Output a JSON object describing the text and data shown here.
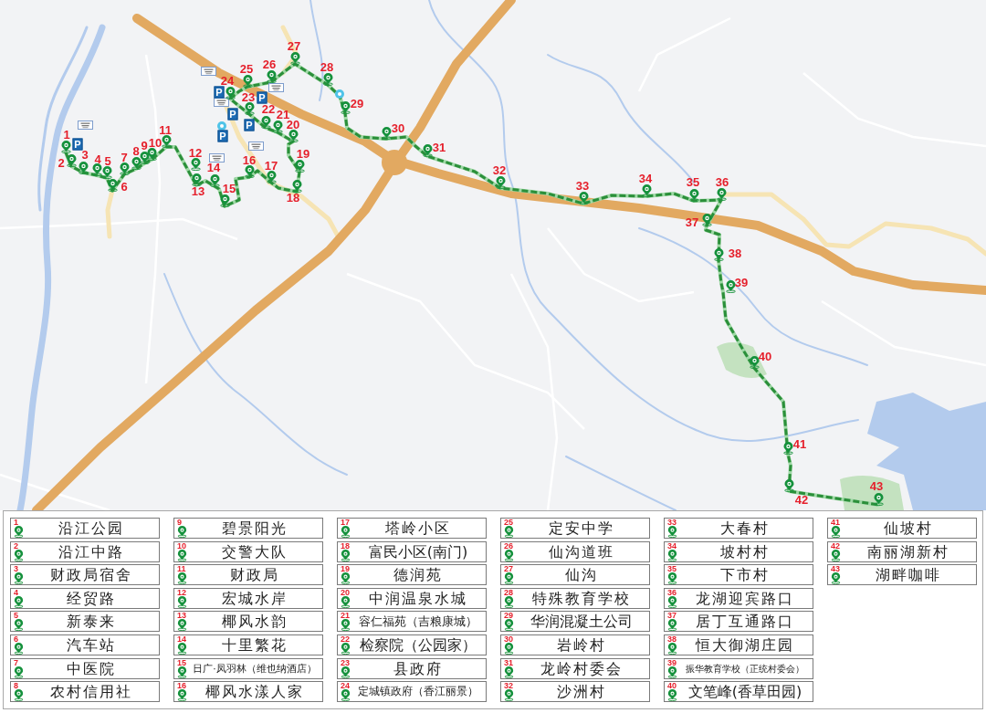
{
  "map": {
    "parking_signs": [
      {
        "label": "P"
      },
      {
        "label": "P"
      },
      {
        "label": "P"
      },
      {
        "label": "P"
      },
      {
        "label": "P"
      },
      {
        "label": "P"
      }
    ],
    "stops": [
      {
        "number": "1"
      },
      {
        "number": "2"
      },
      {
        "number": "3"
      },
      {
        "number": "4"
      },
      {
        "number": "5"
      },
      {
        "number": "6"
      },
      {
        "number": "7"
      },
      {
        "number": "8"
      },
      {
        "number": "9"
      },
      {
        "number": "10"
      },
      {
        "number": "11"
      },
      {
        "number": "12"
      },
      {
        "number": "13"
      },
      {
        "number": "14"
      },
      {
        "number": "15"
      },
      {
        "number": "16"
      },
      {
        "number": "17"
      },
      {
        "number": "18"
      },
      {
        "number": "19"
      },
      {
        "number": "20"
      },
      {
        "number": "21"
      },
      {
        "number": "22"
      },
      {
        "number": "23"
      },
      {
        "number": "24"
      },
      {
        "number": "25"
      },
      {
        "number": "26"
      },
      {
        "number": "27"
      },
      {
        "number": "28"
      },
      {
        "number": "29"
      },
      {
        "number": "30"
      },
      {
        "number": "31"
      },
      {
        "number": "32"
      },
      {
        "number": "33"
      },
      {
        "number": "34"
      },
      {
        "number": "35"
      },
      {
        "number": "36"
      },
      {
        "number": "37"
      },
      {
        "number": "38"
      },
      {
        "number": "39"
      },
      {
        "number": "40"
      },
      {
        "number": "41"
      },
      {
        "number": "42"
      },
      {
        "number": "43"
      }
    ]
  },
  "legend": {
    "entries": [
      {
        "number": "1",
        "name": "沿江公园"
      },
      {
        "number": "2",
        "name": "沿江中路"
      },
      {
        "number": "3",
        "name": "财政局宿舍"
      },
      {
        "number": "4",
        "name": "经贸路"
      },
      {
        "number": "5",
        "name": "新泰来"
      },
      {
        "number": "6",
        "name": "汽车站"
      },
      {
        "number": "7",
        "name": "中医院"
      },
      {
        "number": "8",
        "name": "农村信用社"
      },
      {
        "number": "9",
        "name": "碧景阳光"
      },
      {
        "number": "10",
        "name": "交警大队"
      },
      {
        "number": "11",
        "name": "财政局"
      },
      {
        "number": "12",
        "name": "宏城水岸"
      },
      {
        "number": "13",
        "name": "椰风水韵"
      },
      {
        "number": "14",
        "name": "十里繁花"
      },
      {
        "number": "15",
        "name": "日广·凤羽林（维也纳酒店）"
      },
      {
        "number": "16",
        "name": "椰风水漾人家"
      },
      {
        "number": "17",
        "name": "塔岭小区"
      },
      {
        "number": "18",
        "name": "富民小区(南门)"
      },
      {
        "number": "19",
        "name": "德润苑"
      },
      {
        "number": "20",
        "name": "中润温泉水城"
      },
      {
        "number": "21",
        "name": "容仁福苑（吉粮康城）"
      },
      {
        "number": "22",
        "name": "检察院（公园家）"
      },
      {
        "number": "23",
        "name": "县政府"
      },
      {
        "number": "24",
        "name": "定城镇政府（香江丽景）"
      },
      {
        "number": "25",
        "name": "定安中学"
      },
      {
        "number": "26",
        "name": "仙沟道班"
      },
      {
        "number": "27",
        "name": "仙沟"
      },
      {
        "number": "28",
        "name": "特殊教育学校"
      },
      {
        "number": "29",
        "name": "华润混凝土公司"
      },
      {
        "number": "30",
        "name": "岩岭村"
      },
      {
        "number": "31",
        "name": "龙岭村委会"
      },
      {
        "number": "32",
        "name": "沙洲村"
      },
      {
        "number": "33",
        "name": "大春村"
      },
      {
        "number": "34",
        "name": "坡村村"
      },
      {
        "number": "35",
        "name": "下市村"
      },
      {
        "number": "36",
        "name": "龙湖迎宾路口"
      },
      {
        "number": "37",
        "name": "居丁互通路口"
      },
      {
        "number": "38",
        "name": "恒大御湖庄园"
      },
      {
        "number": "39",
        "name": "振华教育学校（正统村委会）"
      },
      {
        "number": "40",
        "name": "文笔峰(香草田园)"
      },
      {
        "number": "41",
        "name": "仙坡村"
      },
      {
        "number": "42",
        "name": "南丽湖新村"
      },
      {
        "number": "43",
        "name": "湖畔咖啡"
      }
    ]
  }
}
